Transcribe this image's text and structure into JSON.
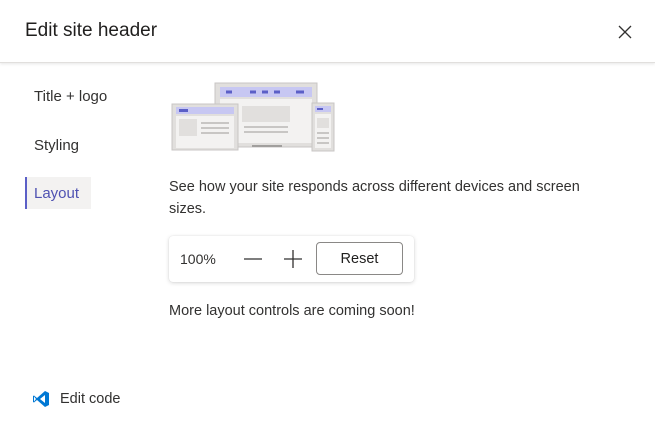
{
  "header": {
    "title": "Edit site header",
    "close_icon": "close-icon"
  },
  "nav": {
    "items": [
      {
        "label": "Title + logo",
        "selected": false
      },
      {
        "label": "Styling",
        "selected": false
      },
      {
        "label": "Layout",
        "selected": true
      }
    ]
  },
  "layout": {
    "illustration_icon": "responsive-devices-icon",
    "description": "See how your site responds across different devices and screen sizes.",
    "zoom": {
      "value": "100%",
      "zoom_out_icon": "minus-icon",
      "zoom_in_icon": "plus-icon",
      "reset_label": "Reset"
    },
    "coming_soon": "More layout controls are coming soon!"
  },
  "footer": {
    "edit_code_label": "Edit code",
    "edit_code_icon": "vscode-icon"
  },
  "colors": {
    "accent": "#5b5fc7",
    "selected_bg": "#f3f2f1",
    "vscode_blue": "#0078d4"
  }
}
